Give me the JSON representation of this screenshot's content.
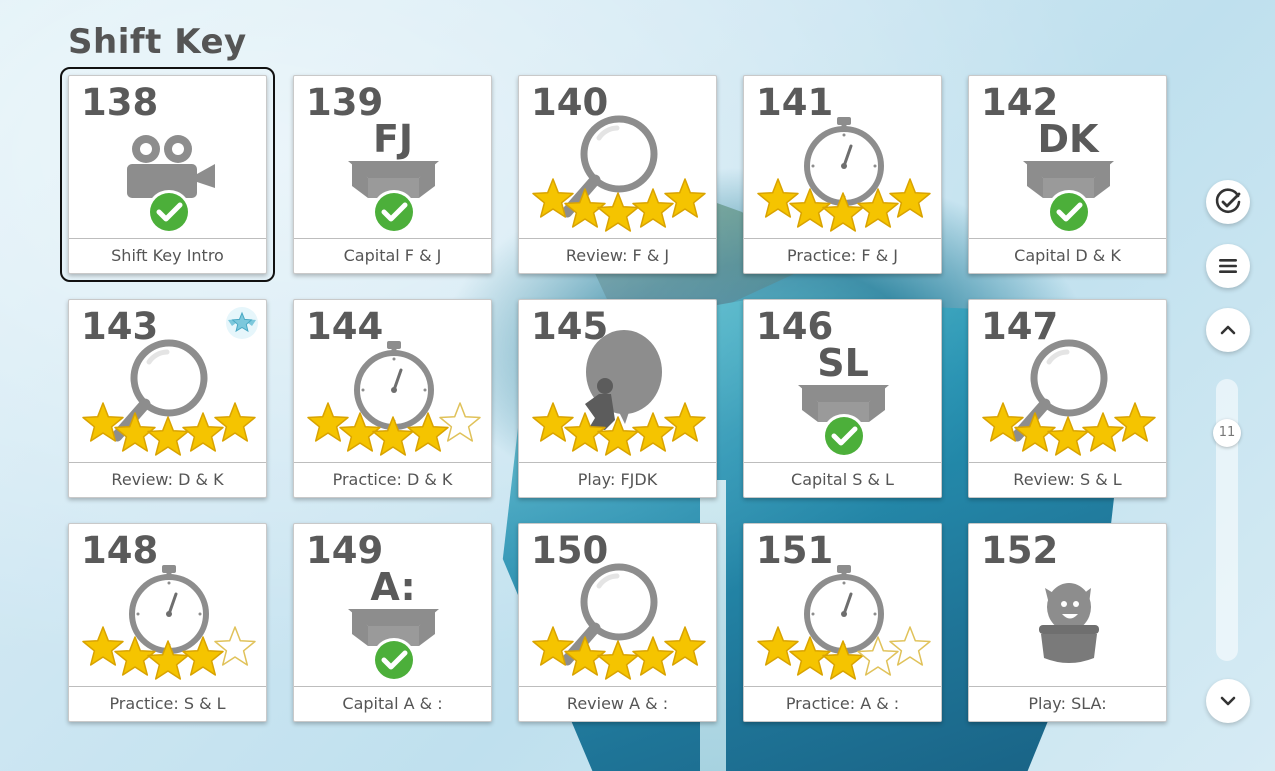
{
  "page": {
    "title": "Shift Key"
  },
  "lessons": [
    {
      "number": "138",
      "label": "Shift Key Intro",
      "art": "video",
      "selected": true
    },
    {
      "number": "139",
      "label": "Capital F & J",
      "art": "box",
      "letters": "FJ"
    },
    {
      "number": "140",
      "label": "Review: F & J",
      "art": "magnifier",
      "stars": 5
    },
    {
      "number": "141",
      "label": "Practice: F & J",
      "art": "stopwatch",
      "stars": 5
    },
    {
      "number": "142",
      "label": "Capital D & K",
      "art": "box",
      "letters": "DK"
    },
    {
      "number": "143",
      "label": "Review: D & K",
      "art": "magnifier",
      "stars": 5,
      "badge": "star-badge"
    },
    {
      "number": "144",
      "label": "Practice: D & K",
      "art": "stopwatch",
      "stars": 4
    },
    {
      "number": "145",
      "label": "Play: FJDK",
      "art": "balloon",
      "stars": 5
    },
    {
      "number": "146",
      "label": "Capital S & L",
      "art": "box",
      "letters": "SL"
    },
    {
      "number": "147",
      "label": "Review: S & L",
      "art": "magnifier",
      "stars": 5
    },
    {
      "number": "148",
      "label": "Practice: S & L",
      "art": "stopwatch",
      "stars": 4
    },
    {
      "number": "149",
      "label": "Capital A & :",
      "art": "box",
      "letters": "A:"
    },
    {
      "number": "150",
      "label": "Review A & :",
      "art": "magnifier",
      "stars": 5
    },
    {
      "number": "151",
      "label": "Practice: A & :",
      "art": "stopwatch",
      "stars": 3
    },
    {
      "number": "152",
      "label": "Play: SLA:",
      "art": "mascot"
    }
  ],
  "sidebar": {
    "progress_icon": "check-circle-icon",
    "menu_icon": "menu-icon",
    "up_icon": "chevron-up-icon",
    "down_icon": "chevron-down-icon",
    "page_indicator": "11"
  },
  "colors": {
    "star_fill": "#f5c400",
    "check_green": "#4caf3a",
    "icon_gray": "#8d8d8d"
  }
}
